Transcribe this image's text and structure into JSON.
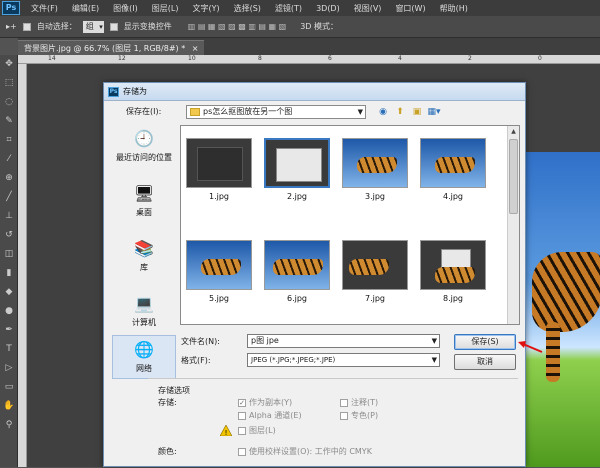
{
  "app": {
    "logo": "Ps",
    "menu": [
      "文件(F)",
      "编辑(E)",
      "图像(I)",
      "图层(L)",
      "文字(Y)",
      "选择(S)",
      "滤镜(T)",
      "3D(D)",
      "视图(V)",
      "窗口(W)",
      "帮助(H)"
    ]
  },
  "options": {
    "auto_select_label": "自动选择：",
    "auto_select_value": "组",
    "transform_label": "显示变换控件",
    "mode_3d": "3D 模式："
  },
  "document_tab": {
    "title": "背景图片.jpg @ 66.7% (图层 1, RGB/8#) *",
    "close": "×"
  },
  "ruler": {
    "marks": [
      "14",
      "12",
      "10",
      "8",
      "6",
      "4",
      "2",
      "0"
    ]
  },
  "dialog": {
    "title": "存储为",
    "lookin_label": "保存在(I):",
    "lookin_value": "ps怎么抠图放在另一个图",
    "places": [
      {
        "label": "最近访问的位置",
        "icon": "recent-places-icon",
        "glyph": "🕘"
      },
      {
        "label": "桌面",
        "icon": "desktop-icon",
        "glyph": "🖥"
      },
      {
        "label": "库",
        "icon": "library-icon",
        "glyph": "📚"
      },
      {
        "label": "计算机",
        "icon": "computer-icon",
        "glyph": "💻"
      },
      {
        "label": "网络",
        "icon": "network-icon",
        "glyph": "🌐"
      }
    ],
    "files": [
      "1.jpg",
      "2.jpg",
      "3.jpg",
      "4.jpg",
      "5.jpg",
      "6.jpg",
      "7.jpg",
      "8.jpg"
    ],
    "filename_label": "文件名(N):",
    "filename_value": "p图 jpe",
    "format_label": "格式(F):",
    "format_value": "JPEG (*.JPG;*.JPEG;*.JPE)",
    "save_button": "保存(S)",
    "cancel_button": "取消",
    "options_title": "存储选项",
    "save_label": "存储:",
    "as_copy": "作为副本(Y)",
    "notes": "注释(T)",
    "alpha": "Alpha 通道(E)",
    "spot": "专色(P)",
    "layers": "图层(L)",
    "color_label": "颜色:",
    "proof_setup": "使用校样设置(O): 工作中的 CMYK"
  }
}
